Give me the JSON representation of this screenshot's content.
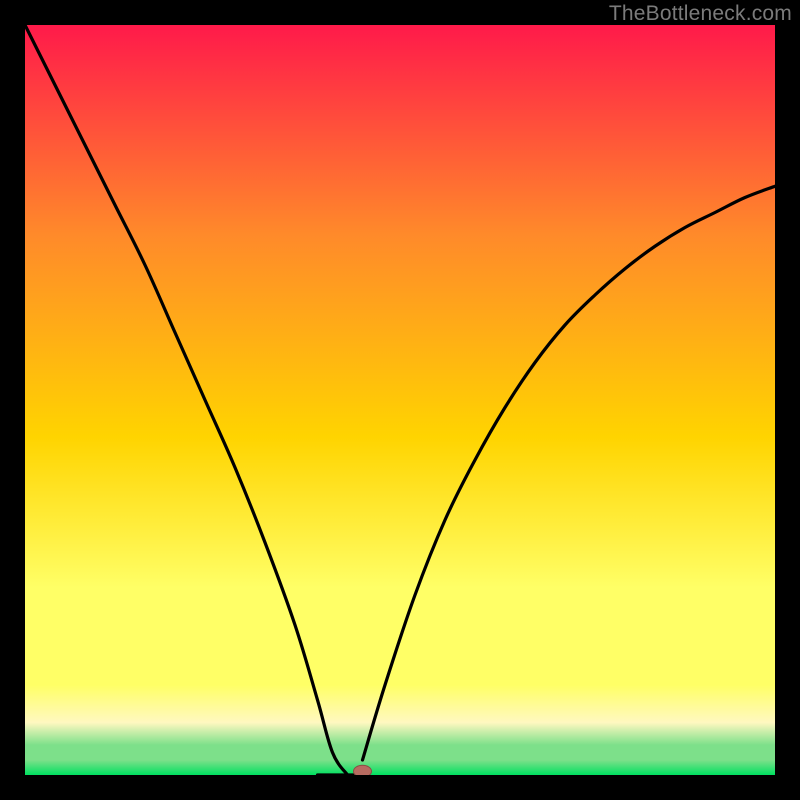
{
  "watermark": "TheBottleneck.com",
  "colors": {
    "top": "#ff1a4a",
    "upper_mid": "#ff8a2a",
    "mid": "#ffd400",
    "lower_mid": "#ffff66",
    "cream": "#fff8c0",
    "green_light": "#7de08a",
    "green": "#00e060",
    "curve": "#000000",
    "marker_fill": "#b76b60",
    "marker_stroke": "#8a4d44",
    "frame": "#000000"
  },
  "chart_data": {
    "type": "line",
    "title": "",
    "xlabel": "",
    "ylabel": "",
    "xlim": [
      0,
      100
    ],
    "ylim": [
      0,
      100
    ],
    "x_min_point": 43,
    "left_curve": {
      "x": [
        0,
        4,
        8,
        12,
        16,
        20,
        24,
        28,
        32,
        36,
        39,
        41,
        43
      ],
      "y": [
        100,
        92,
        84,
        76,
        68,
        59,
        50,
        41,
        31,
        20,
        10,
        3,
        0
      ]
    },
    "right_curve": {
      "x": [
        45,
        48,
        52,
        56,
        60,
        64,
        68,
        72,
        76,
        80,
        84,
        88,
        92,
        96,
        100
      ],
      "y": [
        2,
        12,
        24,
        34,
        42,
        49,
        55,
        60,
        64,
        67.5,
        70.5,
        73,
        75,
        77,
        78.5
      ]
    },
    "flat_segment": {
      "x": [
        39,
        45
      ],
      "y": [
        0,
        0
      ]
    },
    "marker": {
      "x": 45,
      "y": 0.5
    }
  }
}
